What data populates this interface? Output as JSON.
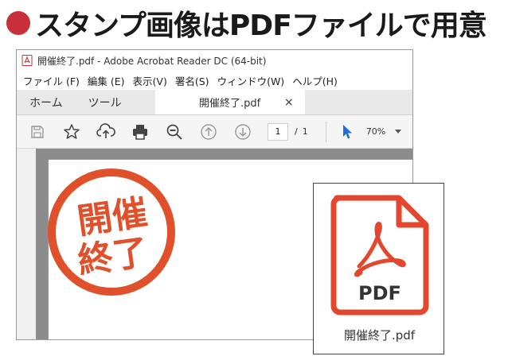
{
  "headline": {
    "text": "スタンプ画像はPDFファイルで用意"
  },
  "window": {
    "title": "開催終了.pdf - Adobe Acrobat Reader DC (64-bit)",
    "menu": [
      "ファイル (F)",
      "編集 (E)",
      "表示(V)",
      "署名(S)",
      "ウィンドウ(W)",
      "ヘルプ(H)"
    ],
    "tabs": {
      "home": "ホーム",
      "tools": "ツール",
      "document": "開催終了.pdf",
      "close": "×"
    },
    "toolbar": {
      "page_current": "1",
      "page_separator": "/",
      "page_total": "1",
      "zoom": "70%"
    }
  },
  "stamp": {
    "line1": "開催",
    "line2": "終了",
    "color": "#e0502a"
  },
  "file_icon": {
    "label": "PDF",
    "caption": "開催終了.pdf",
    "color": "#e3472e"
  },
  "colors": {
    "bullet": "#c8313b",
    "select_tool": "#1f6fd8"
  }
}
